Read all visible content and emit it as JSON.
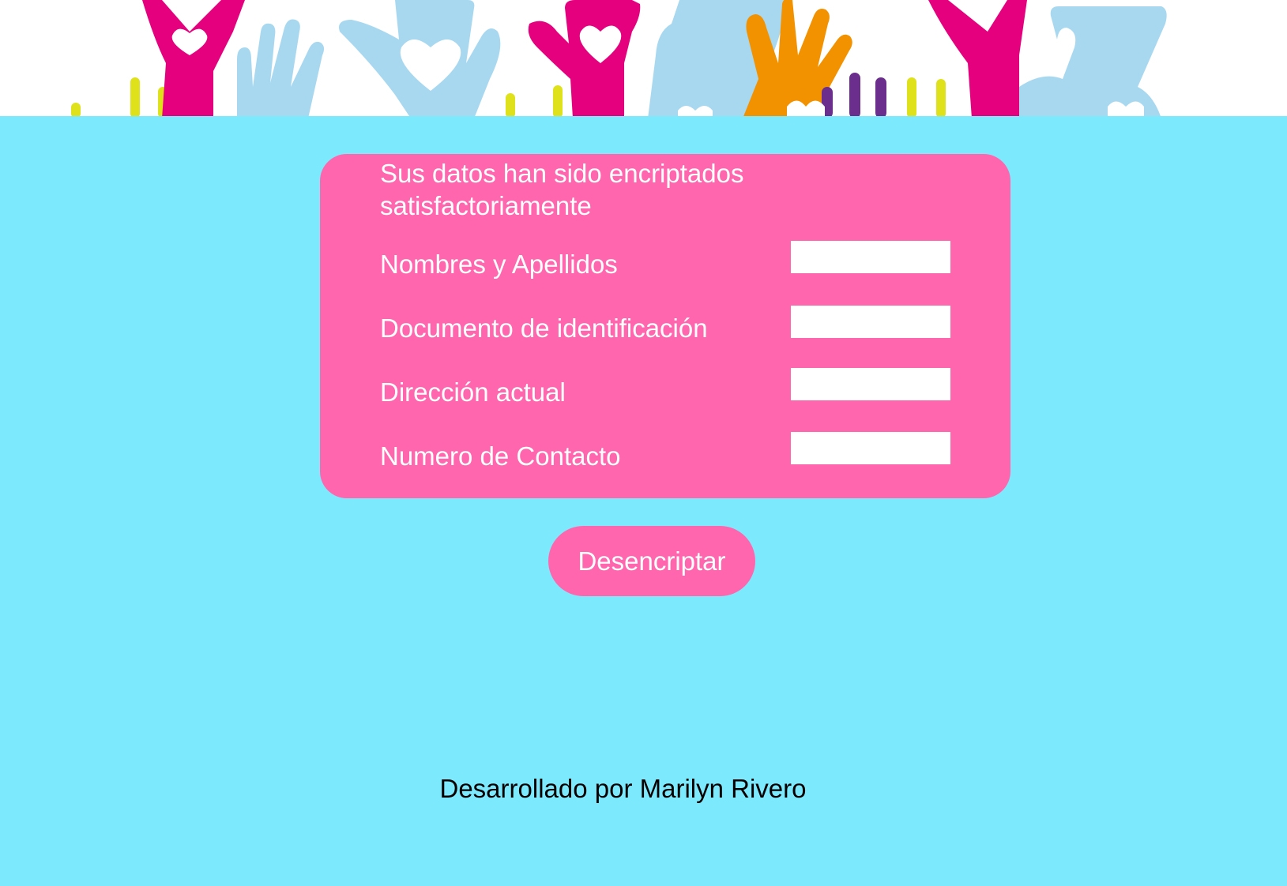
{
  "banner": {
    "image": "raised-hands-hearts-illustration",
    "colors": [
      "#e5007d",
      "#a8d8f0",
      "#f39200",
      "#dfe21a",
      "#6b2e8c"
    ]
  },
  "card": {
    "message": "Sus datos han sido encriptados satisfactoriamente",
    "fields": [
      {
        "label": "Nombres y Apellidos",
        "value": ""
      },
      {
        "label": "Documento de identificación",
        "value": ""
      },
      {
        "label": "Dirección actual",
        "value": ""
      },
      {
        "label": "Numero de Contacto",
        "value": ""
      }
    ]
  },
  "button": {
    "label": "Desencriptar"
  },
  "footer": {
    "credit": "Desarrollado por Marilyn Rivero"
  },
  "colors": {
    "background": "#7de9fd",
    "accent": "#ff66ae",
    "text_light": "#ffffff",
    "text_dark": "#000000"
  }
}
